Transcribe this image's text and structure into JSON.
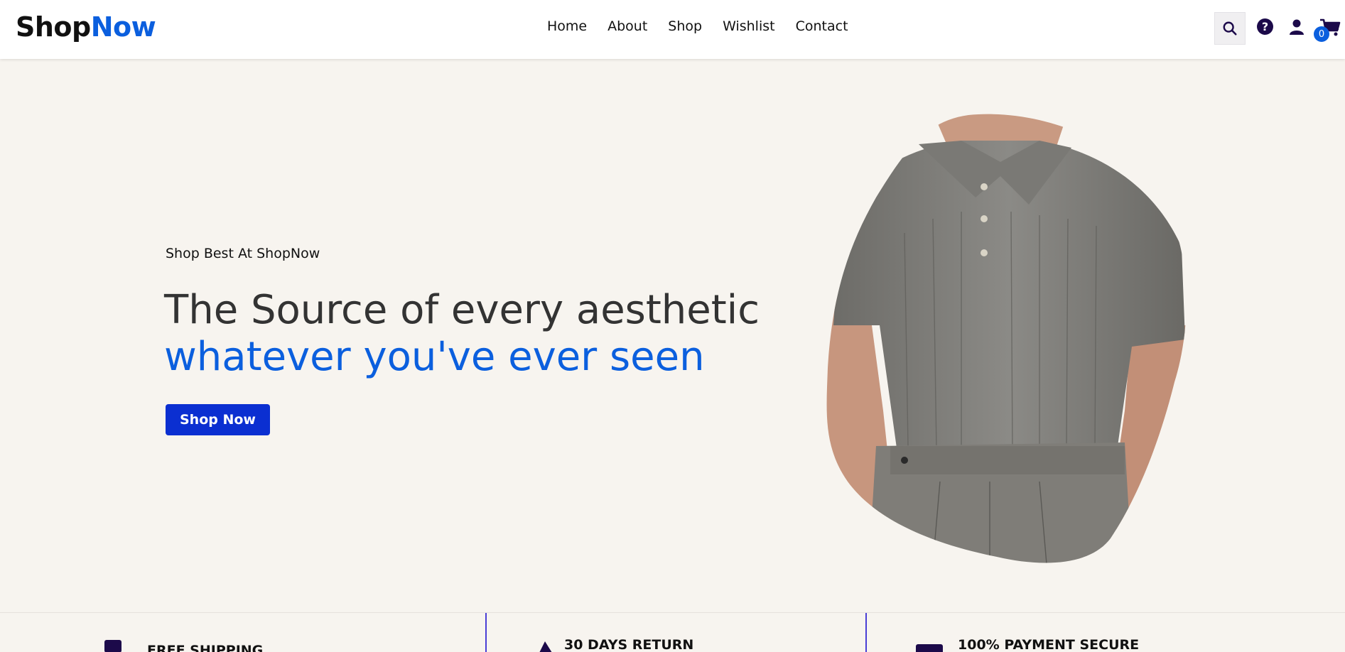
{
  "brand": {
    "name_part1": "Shop",
    "name_part2": "Now",
    "accent": "#0b5fde"
  },
  "nav": {
    "items": [
      "Home",
      "About",
      "Shop",
      "Wishlist",
      "Contact"
    ]
  },
  "header_icons": {
    "search": "search-icon",
    "help": "help-icon",
    "help_glyph": "?",
    "user": "user-icon",
    "cart": "cart-icon",
    "cart_count": "0"
  },
  "hero": {
    "eyebrow": "Shop Best At ShopNow",
    "headline_line1": "The Source of every aesthetic",
    "headline_line2": "whatever you've ever seen",
    "cta_label": "Shop Now",
    "image_alt": "grey knit polo shirt"
  },
  "features": [
    {
      "title": "FREE SHIPPING",
      "icon": "box-icon"
    },
    {
      "title": "30 DAYS RETURN",
      "icon": "return-arrow-icon"
    },
    {
      "title": "100% PAYMENT SECURE",
      "icon": "card-icon"
    }
  ]
}
